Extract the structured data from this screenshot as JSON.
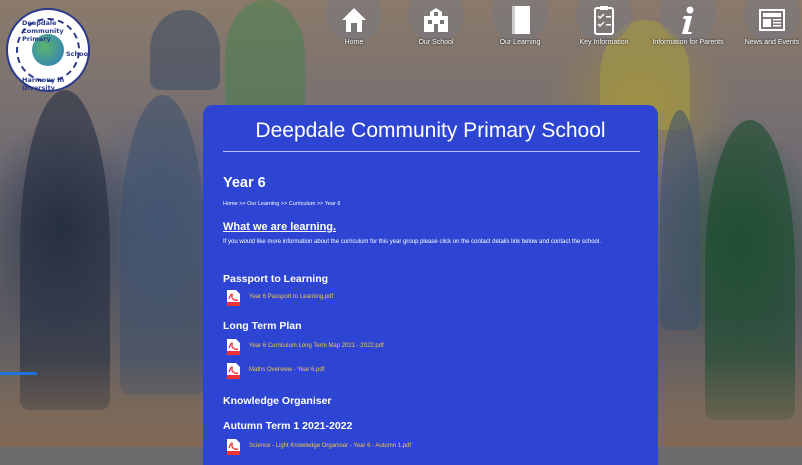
{
  "logo": {
    "top_text": "Deepdale Community Primary",
    "side_text": "School",
    "bottom_text": "Harmony in Diversity"
  },
  "nav": {
    "items": [
      {
        "label": "Home",
        "icon": "home-icon"
      },
      {
        "label": "Our School",
        "icon": "school-icon"
      },
      {
        "label": "Our Learning",
        "icon": "book-icon"
      },
      {
        "label": "Key Information",
        "icon": "clipboard-icon"
      },
      {
        "label": "Information for Parents",
        "icon": "info-icon"
      },
      {
        "label": "News and Events",
        "icon": "newspaper-icon"
      }
    ]
  },
  "main": {
    "site_title": "Deepdale Community Primary School",
    "page_title": "Year 6",
    "breadcrumb": "Home >> Our Learning >> Curriculum >> Year 6",
    "learning_heading": "What we are learning.",
    "intro": "If you would like more information about the curriculum for this year group please click on the contact details link below and contact the school.",
    "sections": {
      "passport": "Passport to Learning",
      "long_term": "Long Term Plan",
      "knowledge": "Knowledge Organiser",
      "autumn": "Autumn Term 1 2021-2022"
    },
    "files": {
      "passport": "Year 6 Passport to Learning.pdf",
      "long_term_map": "Year 6 Curriculum Long Term Map 2021 - 2022.pdf",
      "maths": "Maths Overview - Year 6.pdf",
      "autumn_science": "Science - Light Knowledge Organiser - Year 6 - Autumn 1.pdf"
    }
  },
  "colors": {
    "panel": "#2d45d2",
    "file_link": "#f1c84b",
    "accent_line": "#1e73d8"
  }
}
